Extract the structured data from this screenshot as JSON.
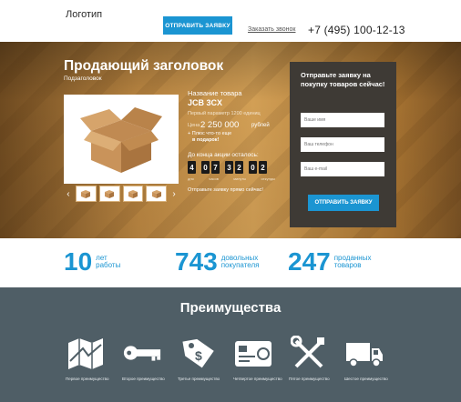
{
  "header": {
    "logo": "Логотип",
    "order_button": "ОТПРАВИТЬ ЗАЯВКУ",
    "call_link": "Заказать звонок",
    "phone": "+7 (495) 100-12-13"
  },
  "hero": {
    "title": "Продающий заголовок",
    "subtitle": "Подзаголовок",
    "product_name_label": "Название товара",
    "product_name": "JCB 3CX",
    "param": "Первый параметр 1200 единиц",
    "price_label": "Цена",
    "price": "2 250 000",
    "price_unit": "рублей",
    "plus_line1": "+ Плюс что-то еще",
    "plus_line2": "в подарок!",
    "countdown_label": "До конца акции осталось:",
    "countdown_digits": [
      "4",
      "0",
      "7",
      "3",
      "2",
      "0",
      "2"
    ],
    "countdown_units": [
      "дня",
      "часов",
      "минуты",
      "секунды"
    ],
    "countdown_note": "Отправьте заявку прямо сейчас!",
    "prev_arrow": "‹",
    "next_arrow": "›"
  },
  "form": {
    "title": "Отправьте заявку на покупку товаров сейчас!",
    "name_placeholder": "Ваше имя",
    "phone_placeholder": "Ваш телефон",
    "email_placeholder": "Ваш e-mail",
    "submit": "ОТПРАВИТЬ ЗАЯВКУ"
  },
  "stats": [
    {
      "number": "10",
      "label1": "лет",
      "label2": "работы"
    },
    {
      "number": "743",
      "label1": "довольных",
      "label2": "покупателя"
    },
    {
      "number": "247",
      "label1": "проданных",
      "label2": "товаров"
    }
  ],
  "advantages": {
    "title": "Преимущества",
    "items": [
      {
        "label": "Первое преимущество",
        "icon": "map-icon"
      },
      {
        "label": "Второе преимущество",
        "icon": "key-icon"
      },
      {
        "label": "Третье преимущество",
        "icon": "price-tag-icon"
      },
      {
        "label": "Четвертое преимущество",
        "icon": "credit-card-icon"
      },
      {
        "label": "Пятое преимущество",
        "icon": "tools-icon"
      },
      {
        "label": "Шестое преимущество",
        "icon": "truck-icon"
      }
    ]
  },
  "colors": {
    "accent": "#1b95d2",
    "panel": "#3e3a35",
    "advantages_bg": "#4f5e66"
  }
}
